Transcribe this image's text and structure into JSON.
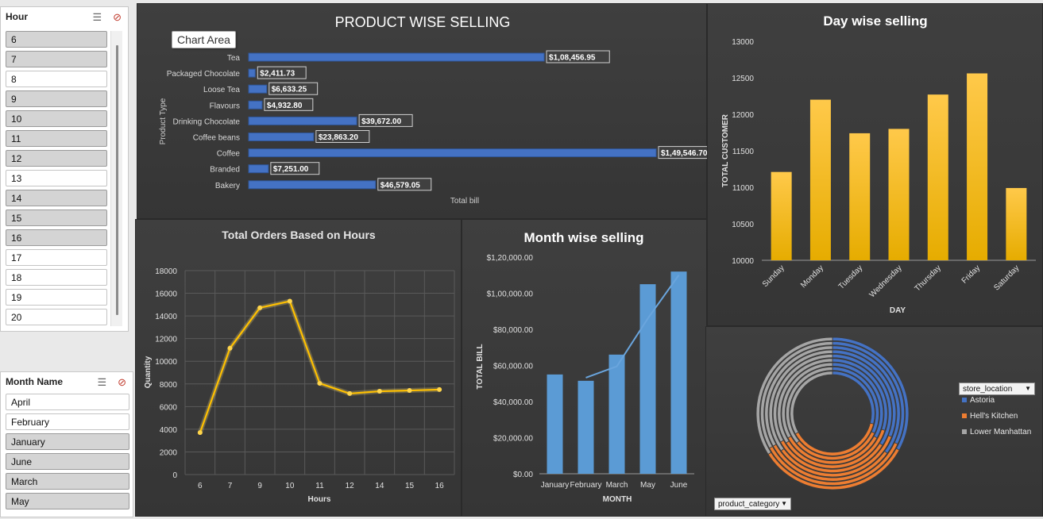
{
  "hour_slicer": {
    "title": "Hour",
    "items": [
      {
        "label": "6",
        "selected": false
      },
      {
        "label": "7",
        "selected": false
      },
      {
        "label": "8",
        "selected": true
      },
      {
        "label": "9",
        "selected": false
      },
      {
        "label": "10",
        "selected": false
      },
      {
        "label": "11",
        "selected": false
      },
      {
        "label": "12",
        "selected": false
      },
      {
        "label": "13",
        "selected": true
      },
      {
        "label": "14",
        "selected": false
      },
      {
        "label": "15",
        "selected": false
      },
      {
        "label": "16",
        "selected": false
      },
      {
        "label": "17",
        "selected": true
      },
      {
        "label": "18",
        "selected": true
      },
      {
        "label": "19",
        "selected": true
      },
      {
        "label": "20",
        "selected": true
      }
    ]
  },
  "month_slicer": {
    "title": "Month Name",
    "items": [
      {
        "label": "April",
        "selected": true
      },
      {
        "label": "February",
        "selected": true
      },
      {
        "label": "January",
        "selected": false
      },
      {
        "label": "June",
        "selected": false
      },
      {
        "label": "March",
        "selected": false
      },
      {
        "label": "May",
        "selected": false
      }
    ]
  },
  "tooltip": "Chart Area",
  "store_location_filter": {
    "label": "store_location"
  },
  "product_category_filter": {
    "label": "product_category"
  },
  "chart_data": [
    {
      "type": "bar",
      "title": "PRODUCT WISE SELLING",
      "xlabel": "Total bill",
      "ylabel": "Product Type",
      "orientation": "horizontal",
      "color": "#4472c4",
      "categories": [
        "Tea",
        "Packaged Chocolate",
        "Loose Tea",
        "Flavours",
        "Drinking Chocolate",
        "Coffee beans",
        "Coffee",
        "Branded",
        "Bakery"
      ],
      "values": [
        108456.95,
        2411.73,
        6633.25,
        4932.8,
        39672.0,
        23863.2,
        149546.7,
        7251.0,
        46579.05
      ],
      "data_labels": [
        "$1,08,456.95",
        "$2,411.73",
        "$6,633.25",
        "$4,932.80",
        "$39,672.00",
        "$23,863.20",
        "$1,49,546.70",
        "$7,251.00",
        "$46,579.05"
      ],
      "xlim": [
        0,
        149546.7
      ]
    },
    {
      "type": "bar",
      "title": "Day wise selling",
      "xlabel": "DAY",
      "ylabel": "TOTAL CUSTOMER",
      "color": "#ffc000",
      "categories": [
        "Sunday",
        "Monday",
        "Tuesday",
        "Wednesday",
        "Thursday",
        "Friday",
        "Saturday"
      ],
      "values": [
        11210,
        12200,
        11740,
        11800,
        12270,
        12560,
        10990
      ],
      "ylim": [
        10000,
        13000
      ],
      "yticks": [
        "10000",
        "10500",
        "11000",
        "11500",
        "12000",
        "12500",
        "13000"
      ]
    },
    {
      "type": "line",
      "title": "Total Orders Based on Hours",
      "xlabel": "Hours",
      "ylabel": "Quantity",
      "color": "#ffc000",
      "grid": true,
      "x": [
        "6",
        "7",
        "9",
        "10",
        "11",
        "12",
        "14",
        "15",
        "16"
      ],
      "values": [
        3700,
        11150,
        14720,
        15300,
        8050,
        7150,
        7350,
        7420,
        7500
      ],
      "ylim": [
        0,
        18000
      ],
      "yticks": [
        "0",
        "2000",
        "4000",
        "6000",
        "8000",
        "10000",
        "12000",
        "14000",
        "16000",
        "18000"
      ]
    },
    {
      "type": "bar",
      "title": "Month wise selling",
      "xlabel": "MONTH",
      "ylabel": "TOTAL BILL",
      "color": "#5b9bd5",
      "trendline": true,
      "categories": [
        "January",
        "February",
        "March",
        "May",
        "June"
      ],
      "values": [
        55000,
        51500,
        66000,
        105000,
        112000
      ],
      "trend_values": [
        null,
        53200,
        59500,
        86000,
        110000
      ],
      "ylim": [
        0,
        120000
      ],
      "yticks": [
        "$0.00",
        "$20,000.00",
        "$40,000.00",
        "$60,000.00",
        "$80,000.00",
        "$1,00,000.00",
        "$1,20,000.00"
      ]
    },
    {
      "type": "pie",
      "subtype": "doughnut",
      "legend": "right",
      "series_names": [
        "Astoria",
        "Hell's Kitchen",
        "Lower Manhattan"
      ],
      "colors": [
        "#4472c4",
        "#ed7d31",
        "#a5a5a5"
      ],
      "rings": [
        [
          0.33,
          0.33,
          0.34
        ],
        [
          0.32,
          0.35,
          0.33
        ],
        [
          0.35,
          0.32,
          0.33
        ],
        [
          0.31,
          0.34,
          0.35
        ],
        [
          0.34,
          0.33,
          0.33
        ],
        [
          0.3,
          0.36,
          0.34
        ],
        [
          0.33,
          0.34,
          0.33
        ],
        [
          0.32,
          0.32,
          0.36
        ],
        [
          0.29,
          0.38,
          0.33
        ]
      ]
    }
  ]
}
